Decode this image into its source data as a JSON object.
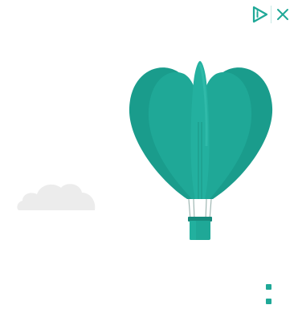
{
  "ad": {
    "controls": {
      "ad_choices_icon": "ad-choices-icon",
      "close_icon": "close-icon"
    },
    "illustration": {
      "balloon_icon": "hot-air-balloon",
      "cloud_icon": "cloud",
      "dot_icon": "small-square"
    },
    "colors": {
      "accent": "#1fa897",
      "accent_dark": "#178a7c",
      "cloud": "#ececec",
      "background": "#ffffff"
    }
  }
}
